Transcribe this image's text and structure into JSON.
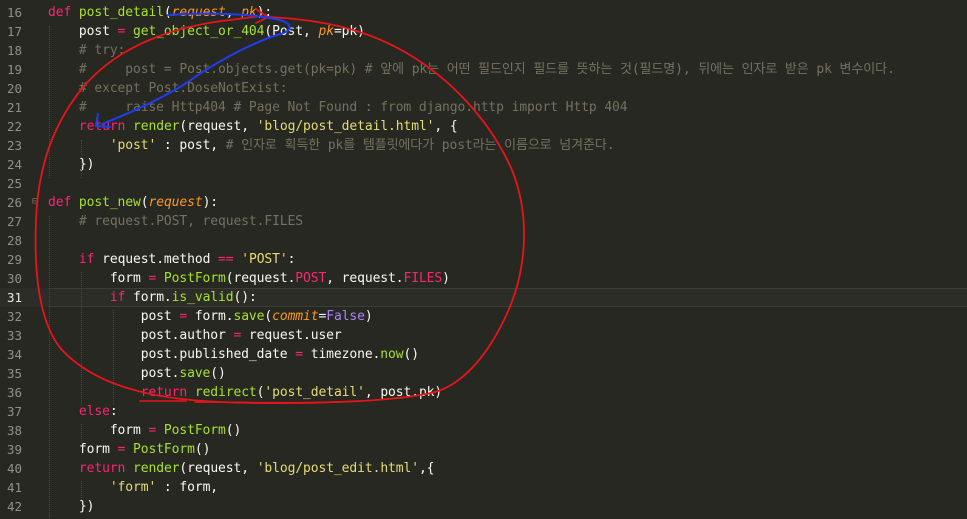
{
  "editor": {
    "lines": [
      {
        "num": "16",
        "tokens": [
          {
            "t": "def ",
            "c": "k"
          },
          {
            "t": "post_detail",
            "c": "fn"
          },
          {
            "t": "("
          },
          {
            "t": "request",
            "c": "p"
          },
          {
            "t": ", "
          },
          {
            "t": "pk",
            "c": "p"
          },
          {
            "t": "):"
          }
        ]
      },
      {
        "num": "17",
        "tokens": [
          {
            "t": "    post "
          },
          {
            "t": "=",
            "c": "k"
          },
          {
            "t": " "
          },
          {
            "t": "get_object_or_404",
            "c": "fn"
          },
          {
            "t": "(Post, "
          },
          {
            "t": "pk",
            "c": "p"
          },
          {
            "t": "="
          },
          {
            "t": "pk)"
          }
        ]
      },
      {
        "num": "18",
        "tokens": [
          {
            "t": "    # try:",
            "c": "c"
          }
        ]
      },
      {
        "num": "19",
        "tokens": [
          {
            "t": "    #     post = Post.objects.get(pk=pk) # 앞에 pk는 어떤 필드인지 필드를 뜻하는 것(필드명), 뒤에는 인자로 받은 pk 변수이다.",
            "c": "c"
          }
        ]
      },
      {
        "num": "20",
        "tokens": [
          {
            "t": "    # except Post.DoseNotExist:",
            "c": "c"
          }
        ]
      },
      {
        "num": "21",
        "tokens": [
          {
            "t": "    #     raise Http404 # Page Not Found : from django.http import Http 404",
            "c": "c"
          }
        ]
      },
      {
        "num": "22",
        "tokens": [
          {
            "t": "    "
          },
          {
            "t": "return",
            "c": "k"
          },
          {
            "t": " "
          },
          {
            "t": "render",
            "c": "fn"
          },
          {
            "t": "(request, "
          },
          {
            "t": "'blog/post_detail.html'",
            "c": "s"
          },
          {
            "t": ", {"
          }
        ]
      },
      {
        "num": "23",
        "tokens": [
          {
            "t": "        "
          },
          {
            "t": "'post'",
            "c": "s"
          },
          {
            "t": " : post, "
          },
          {
            "t": "# 인자로 획득한 pk를 템플릿에다가 post라는 이름으로 넘겨준다.",
            "c": "c"
          }
        ]
      },
      {
        "num": "24",
        "tokens": [
          {
            "t": "    })"
          }
        ]
      },
      {
        "num": "25",
        "tokens": []
      },
      {
        "num": "26",
        "fold": true,
        "tokens": [
          {
            "t": "def ",
            "c": "k"
          },
          {
            "t": "post_new",
            "c": "fn"
          },
          {
            "t": "("
          },
          {
            "t": "request",
            "c": "p"
          },
          {
            "t": "):"
          }
        ]
      },
      {
        "num": "27",
        "tokens": [
          {
            "t": "    # request.POST, request.FILES",
            "c": "c"
          }
        ]
      },
      {
        "num": "28",
        "tokens": []
      },
      {
        "num": "29",
        "tokens": [
          {
            "t": "    "
          },
          {
            "t": "if",
            "c": "k"
          },
          {
            "t": " request.method "
          },
          {
            "t": "==",
            "c": "k"
          },
          {
            "t": " "
          },
          {
            "t": "'POST'",
            "c": "s"
          },
          {
            "t": ":"
          }
        ]
      },
      {
        "num": "30",
        "tokens": [
          {
            "t": "        form "
          },
          {
            "t": "=",
            "c": "k"
          },
          {
            "t": " "
          },
          {
            "t": "PostForm",
            "c": "fn"
          },
          {
            "t": "(request."
          },
          {
            "t": "POST",
            "c": "k"
          },
          {
            "t": ", request."
          },
          {
            "t": "FILES",
            "c": "k"
          },
          {
            "t": ")"
          }
        ]
      },
      {
        "num": "31",
        "current": true,
        "tokens": [
          {
            "t": "        "
          },
          {
            "t": "if",
            "c": "k"
          },
          {
            "t": " form."
          },
          {
            "t": "is_valid",
            "c": "fn"
          },
          {
            "t": "():"
          }
        ]
      },
      {
        "num": "32",
        "tokens": [
          {
            "t": "            post "
          },
          {
            "t": "=",
            "c": "k"
          },
          {
            "t": " form."
          },
          {
            "t": "save",
            "c": "fn"
          },
          {
            "t": "("
          },
          {
            "t": "commit",
            "c": "p"
          },
          {
            "t": "="
          },
          {
            "t": "False",
            "c": "cn"
          },
          {
            "t": ")"
          }
        ]
      },
      {
        "num": "33",
        "tokens": [
          {
            "t": "            post.author "
          },
          {
            "t": "=",
            "c": "k"
          },
          {
            "t": " request.user"
          }
        ]
      },
      {
        "num": "34",
        "tokens": [
          {
            "t": "            post.published_date "
          },
          {
            "t": "=",
            "c": "k"
          },
          {
            "t": " timezone."
          },
          {
            "t": "now",
            "c": "fn"
          },
          {
            "t": "()"
          }
        ]
      },
      {
        "num": "35",
        "tokens": [
          {
            "t": "            post."
          },
          {
            "t": "save",
            "c": "fn"
          },
          {
            "t": "()"
          }
        ]
      },
      {
        "num": "36",
        "tokens": [
          {
            "t": "            "
          },
          {
            "t": "return",
            "c": "k"
          },
          {
            "t": " "
          },
          {
            "t": "redirect",
            "c": "fn"
          },
          {
            "t": "("
          },
          {
            "t": "'post_detail'",
            "c": "s"
          },
          {
            "t": ", post.pk)"
          }
        ]
      },
      {
        "num": "37",
        "tokens": [
          {
            "t": "    "
          },
          {
            "t": "else",
            "c": "k"
          },
          {
            "t": ":"
          }
        ]
      },
      {
        "num": "38",
        "tokens": [
          {
            "t": "        form "
          },
          {
            "t": "=",
            "c": "k"
          },
          {
            "t": " "
          },
          {
            "t": "PostForm",
            "c": "fn"
          },
          {
            "t": "()"
          }
        ]
      },
      {
        "num": "39",
        "tokens": [
          {
            "t": "    form "
          },
          {
            "t": "=",
            "c": "k"
          },
          {
            "t": " "
          },
          {
            "t": "PostForm",
            "c": "fn"
          },
          {
            "t": "()"
          }
        ]
      },
      {
        "num": "40",
        "tokens": [
          {
            "t": "    "
          },
          {
            "t": "return",
            "c": "k"
          },
          {
            "t": " "
          },
          {
            "t": "render",
            "c": "fn"
          },
          {
            "t": "(request, "
          },
          {
            "t": "'blog/post_edit.html'",
            "c": "s"
          },
          {
            "t": ",{"
          }
        ]
      },
      {
        "num": "41",
        "tokens": [
          {
            "t": "        "
          },
          {
            "t": "'form'",
            "c": "s"
          },
          {
            "t": " : form,"
          }
        ]
      },
      {
        "num": "42",
        "tokens": [
          {
            "t": "    })"
          }
        ]
      }
    ]
  },
  "theme": {
    "background": "#272822",
    "keyword": "#f92672",
    "function": "#a6e22e",
    "parameter": "#fd971f",
    "string": "#e6db74",
    "comment": "#75715e",
    "constant": "#ae81ff",
    "annotation_red": "#e8141c",
    "annotation_blue": "#1f3df0"
  },
  "annotations": {
    "red_loop": "hand-drawn red circle around post_new body",
    "blue_arrow": "hand-drawn blue arrow from post_detail to return render"
  }
}
